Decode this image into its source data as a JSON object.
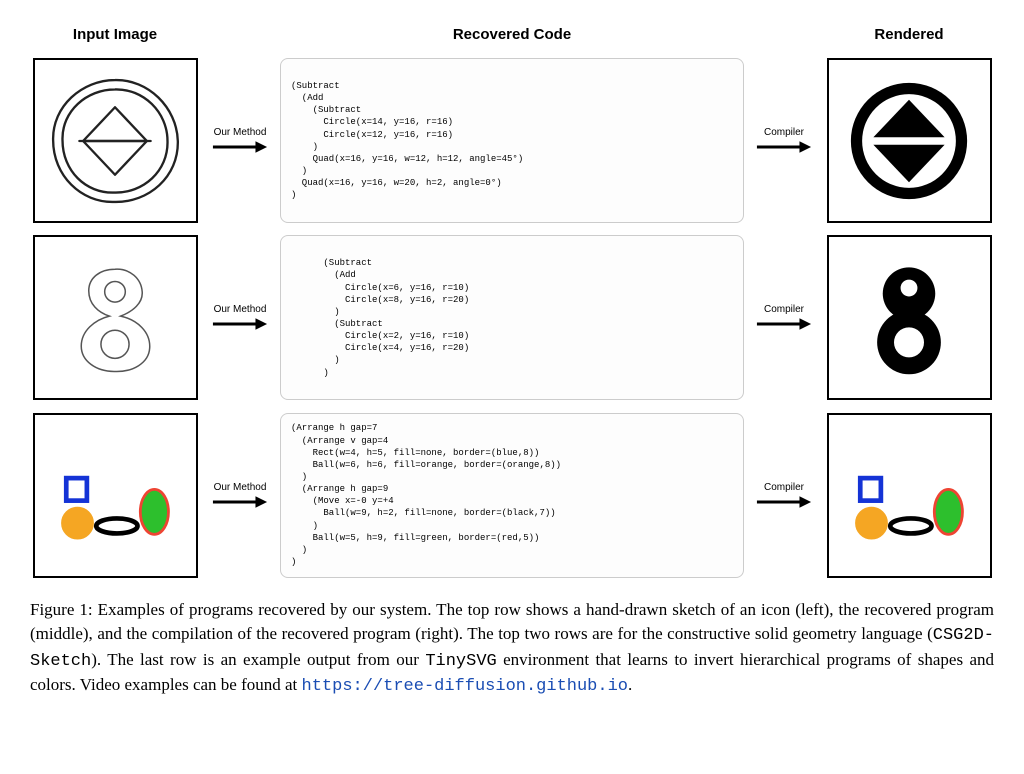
{
  "headers": {
    "col1": "Input Image",
    "col2": "Recovered Code",
    "col3": "Rendered"
  },
  "arrows": {
    "our_method": "Our Method",
    "compiler": "Compiler"
  },
  "code": {
    "row1": "(Subtract\n  (Add\n    (Subtract\n      Circle(x=14, y=16, r=16)\n      Circle(x=12, y=16, r=16)\n    )\n    Quad(x=16, y=16, w=12, h=12, angle=45°)\n  )\n  Quad(x=16, y=16, w=20, h=2, angle=0°)\n)",
    "row2": "      (Subtract\n        (Add\n          Circle(x=6, y=16, r=10)\n          Circle(x=8, y=16, r=20)\n        )\n        (Subtract\n          Circle(x=2, y=16, r=10)\n          Circle(x=4, y=16, r=20)\n        )\n      )",
    "row3": "(Arrange h gap=7\n  (Arrange v gap=4\n    Rect(w=4, h=5, fill=none, border=(blue,8))\n    Ball(w=6, h=6, fill=orange, border=(orange,8))\n  )\n  (Arrange h gap=9\n    (Move x=-0 y=+4\n      Ball(w=9, h=2, fill=none, border=(black,7))\n    )\n    Ball(w=5, h=9, fill=green, border=(red,5))\n  )\n)"
  },
  "caption": {
    "prefix": "Figure 1: Examples of programs recovered by our system. The top row shows a hand-drawn sketch of an icon (left), the recovered program (middle), and the compilation of the recovered program (right). The top two rows are for the constructive solid geometry language (",
    "code1": "CSG2D-Sketch",
    "mid1": "). The last row is an example output from our ",
    "code2": "TinySVG",
    "mid2": " environment that learns to invert hierarchical programs of shapes and colors. Video examples can be found at ",
    "link": "https://tree-diffusion.github.io",
    "suffix": "."
  }
}
